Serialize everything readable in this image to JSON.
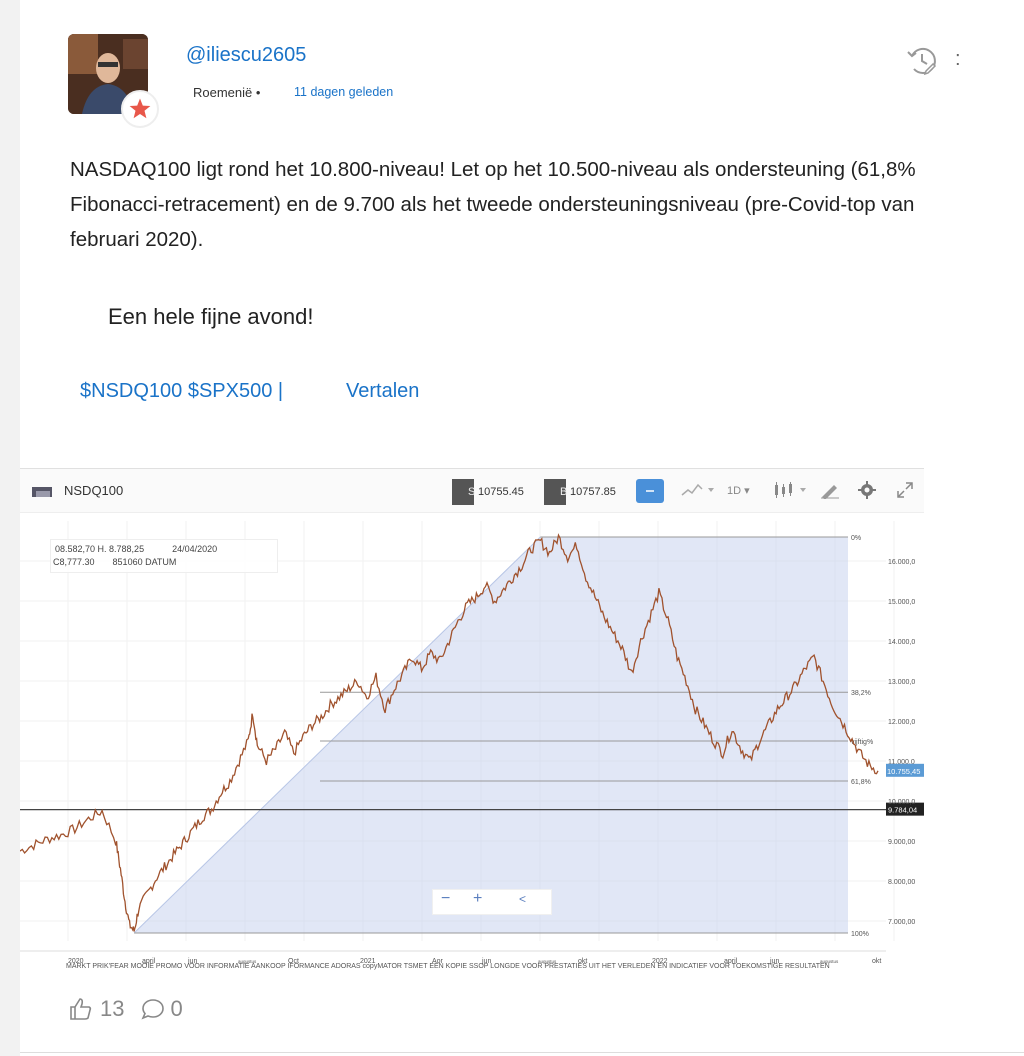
{
  "post": {
    "username": "@iliescu2605",
    "country": "Roemenië •",
    "time_ago": "11 dagen geleden",
    "body": "NASDAQ100 ligt rond het 10.800-niveau! Let op het 10.500-niveau als ondersteuning (61,8% Fibonacci-retracement) en de 9.700 als het tweede ondersteuningsniveau (pre-Covid-top van februari 2020).",
    "greeting": "Een hele fijne avond!",
    "tags": "$NSDQ100 $SPX500 |",
    "translate_label": "Vertalen",
    "likes": "13",
    "comments": "0"
  },
  "chart_toolbar": {
    "symbol": "NSDQ100",
    "sell_price": "10755.45",
    "sell_prefix": "S",
    "buy_price": "10757.85",
    "buy_prefix": "B",
    "timeframe": "1D"
  },
  "ohlc": {
    "line1": "08.582,70 H. 8.788,25",
    "date": "24/04/2020",
    "line2": "C8,777.30",
    "line3": "851060 DATUM"
  },
  "zoom": {
    "minus": "−",
    "plus": "+",
    "back": "<"
  },
  "disclaimer": "MARKT PRIK'FEAR MOOIE PROMO VOOR INFORMATIE AANKOOP IFORMANCE ADORAS copyMATOR TSMET EEN KOPIE SSOP LONGDE VOOR PRESTATIES UIT HET VERLEDEN EN INDICATIEF VOOR TOEKOMSTIGE RESULTATEN",
  "chart_data": {
    "type": "line",
    "x_ticks": [
      "2020",
      "april",
      "jun",
      "augustus",
      "Oct",
      "2021",
      "Aor",
      "jun",
      "augustus",
      "okt",
      "2022",
      "april",
      "jun",
      "augustus",
      "okt"
    ],
    "y_ticks": [
      "16.000,0",
      "15.000,0",
      "14.000,0",
      "13.000,0",
      "12.000,0",
      "11.000,0",
      "10.000,0",
      "9.000,00",
      "8.000,00",
      "7.000,00"
    ],
    "ylim": [
      6500,
      17000
    ],
    "fib_levels": [
      {
        "label": "0%",
        "value": 16600
      },
      {
        "label": "38,2%",
        "value": 12720
      },
      {
        "label": "vijftig%",
        "value": 11500
      },
      {
        "label": "61,8%",
        "value": 10500
      },
      {
        "label": "100%",
        "value": 6700
      }
    ],
    "horizontal_line": {
      "label": "9.784,04",
      "value": 9784
    },
    "last_price_label": "10.755,45",
    "last_price": 10755,
    "series": [
      {
        "values": [
          [
            0,
            8750
          ],
          [
            3,
            8900
          ],
          [
            6,
            9050
          ],
          [
            9,
            9150
          ],
          [
            12,
            9300
          ],
          [
            15,
            9550
          ],
          [
            18,
            9750
          ],
          [
            21,
            9000
          ],
          [
            22,
            8300
          ],
          [
            23,
            7500
          ],
          [
            24,
            6900
          ],
          [
            25,
            6750
          ],
          [
            26,
            7300
          ],
          [
            28,
            7700
          ],
          [
            30,
            8100
          ],
          [
            32,
            8400
          ],
          [
            34,
            8700
          ],
          [
            36,
            9000
          ],
          [
            38,
            9300
          ],
          [
            40,
            9600
          ],
          [
            42,
            9800
          ],
          [
            44,
            10200
          ],
          [
            46,
            10500
          ],
          [
            48,
            11000
          ],
          [
            50,
            11500
          ],
          [
            51,
            12200
          ],
          [
            52,
            11400
          ],
          [
            54,
            11000
          ],
          [
            56,
            11300
          ],
          [
            58,
            11700
          ],
          [
            60,
            11200
          ],
          [
            62,
            11600
          ],
          [
            64,
            11900
          ],
          [
            66,
            12100
          ],
          [
            68,
            12400
          ],
          [
            70,
            12600
          ],
          [
            72,
            12800
          ],
          [
            74,
            13000
          ],
          [
            76,
            12600
          ],
          [
            78,
            13100
          ],
          [
            80,
            12300
          ],
          [
            82,
            12800
          ],
          [
            84,
            13200
          ],
          [
            86,
            13600
          ],
          [
            88,
            13300
          ],
          [
            90,
            13700
          ],
          [
            92,
            13500
          ],
          [
            94,
            14000
          ],
          [
            96,
            14500
          ],
          [
            98,
            14900
          ],
          [
            100,
            15100
          ],
          [
            102,
            15400
          ],
          [
            104,
            15000
          ],
          [
            106,
            15300
          ],
          [
            108,
            15600
          ],
          [
            110,
            15900
          ],
          [
            112,
            16300
          ],
          [
            114,
            16500
          ],
          [
            116,
            16200
          ],
          [
            118,
            16600
          ],
          [
            120,
            16100
          ],
          [
            122,
            16400
          ],
          [
            124,
            15600
          ],
          [
            126,
            15100
          ],
          [
            128,
            14600
          ],
          [
            130,
            14200
          ],
          [
            132,
            13800
          ],
          [
            134,
            13200
          ],
          [
            136,
            14000
          ],
          [
            138,
            14600
          ],
          [
            140,
            15200
          ],
          [
            142,
            14500
          ],
          [
            144,
            13600
          ],
          [
            146,
            13000
          ],
          [
            148,
            12300
          ],
          [
            150,
            11900
          ],
          [
            152,
            11500
          ],
          [
            154,
            11200
          ],
          [
            156,
            11800
          ],
          [
            158,
            11300
          ],
          [
            160,
            11000
          ],
          [
            162,
            11500
          ],
          [
            164,
            11900
          ],
          [
            166,
            12300
          ],
          [
            168,
            12600
          ],
          [
            170,
            12900
          ],
          [
            172,
            13300
          ],
          [
            174,
            13600
          ],
          [
            176,
            13000
          ],
          [
            178,
            12400
          ],
          [
            180,
            12000
          ],
          [
            182,
            11600
          ],
          [
            184,
            11200
          ],
          [
            186,
            10900
          ],
          [
            188,
            10755
          ]
        ]
      }
    ]
  }
}
